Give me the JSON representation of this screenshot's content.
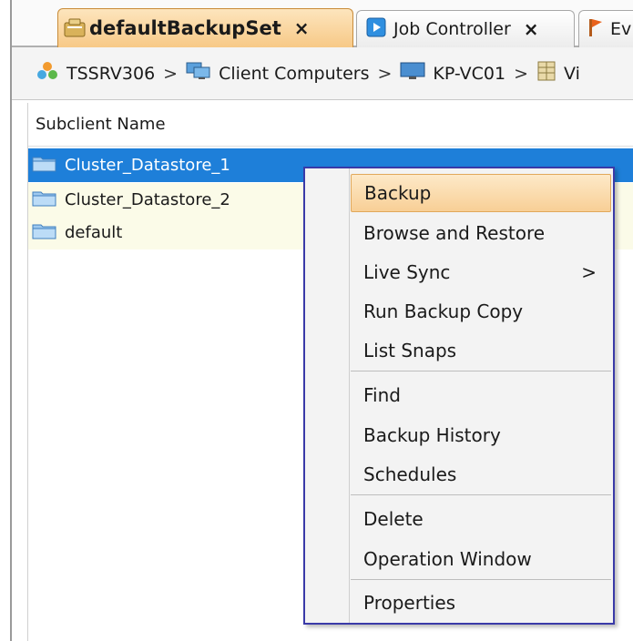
{
  "tabs": [
    {
      "label": "defaultBackupSet",
      "close": "×",
      "icon": "backupset-icon"
    },
    {
      "label": "Job Controller",
      "close": "×",
      "icon": "job-controller-icon"
    },
    {
      "label": "Ev",
      "icon": "event-flag-icon"
    }
  ],
  "breadcrumb": [
    {
      "label": "TSSRV306",
      "icon": "commcell-icon"
    },
    {
      "label": "Client Computers",
      "icon": "client-computers-icon"
    },
    {
      "label": "KP-VC01",
      "icon": "computer-icon"
    },
    {
      "label": "Vi",
      "icon": "instance-icon"
    }
  ],
  "breadcrumb_separator": ">",
  "grid": {
    "column_header": "Subclient Name",
    "rows": [
      {
        "name": "Cluster_Datastore_1",
        "selected": true
      },
      {
        "name": "Cluster_Datastore_2",
        "selected": false
      },
      {
        "name": "default",
        "selected": false
      }
    ]
  },
  "context_menu": {
    "items": [
      {
        "label": "Backup",
        "highlighted": true
      },
      {
        "label": "Browse and Restore"
      },
      {
        "label": "Live Sync",
        "submenu_arrow": ">"
      },
      {
        "label": "Run Backup Copy"
      },
      {
        "label": "List Snaps"
      },
      {
        "label": "Find"
      },
      {
        "label": "Backup History"
      },
      {
        "label": "Schedules"
      },
      {
        "label": "Delete"
      },
      {
        "label": "Operation Window"
      },
      {
        "label": "Properties"
      }
    ]
  },
  "colors": {
    "selection": "#1e7fd9",
    "active_tab": "#f7c987",
    "menu_border": "#3a3aa8",
    "menu_highlight": "#f8cf96"
  }
}
